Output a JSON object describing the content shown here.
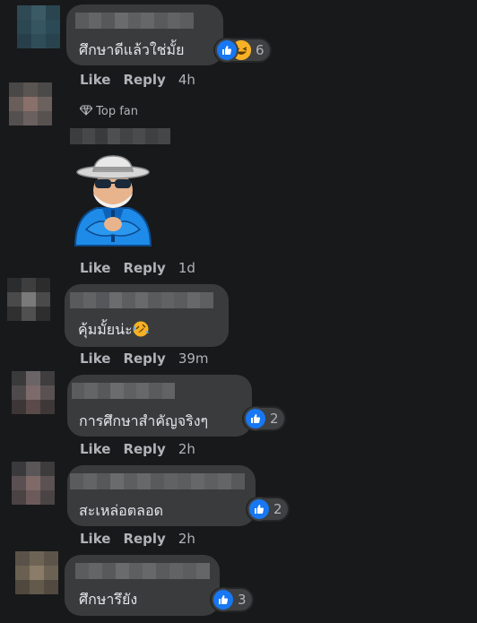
{
  "colors": {
    "background": "#18191a",
    "bubble": "#3a3b3c",
    "text": "#e4e6eb",
    "muted": "#b0b3b8",
    "like": "#1877f2",
    "haha": "#f7b125"
  },
  "actions": {
    "like": "Like",
    "reply": "Reply"
  },
  "comments": [
    {
      "text": "ศึกษาดีแล้วใช่มั้ย",
      "time": "4h",
      "reactions": {
        "icons": [
          "like-icon",
          "haha-icon"
        ],
        "count": "6"
      }
    },
    {
      "badge": "Top fan",
      "sticker": "old-man-in-blue-jacket-sticker",
      "time": "1d"
    },
    {
      "text": "คุ้มมั้ยน่ะ",
      "emoji": "rolling-on-floor-laughing-emoji",
      "time": "39m"
    },
    {
      "text": "การศึกษาสำคัญจริงๆ",
      "time": "2h",
      "reactions": {
        "icons": [
          "like-icon"
        ],
        "count": "2"
      }
    },
    {
      "text": "สะเหล่อตลอด",
      "time": "2h",
      "reactions": {
        "icons": [
          "like-icon"
        ],
        "count": "2"
      }
    },
    {
      "text": "ศึกษารึยัง",
      "reactions": {
        "icons": [
          "like-icon"
        ],
        "count": "3"
      }
    }
  ]
}
